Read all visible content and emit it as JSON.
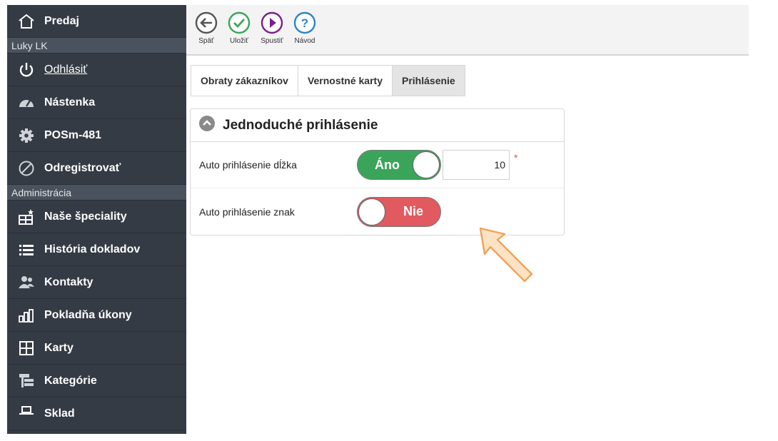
{
  "sidebar": {
    "top_item": {
      "label": "Predaj",
      "icon": "home-icon"
    },
    "user_label": "Luky LK",
    "logout": {
      "label": "Odhlásiť",
      "icon": "power-icon"
    },
    "items_main": [
      {
        "label": "Nástenka",
        "icon": "dashboard-icon"
      },
      {
        "label": "POSm-481",
        "icon": "gear-icon"
      },
      {
        "label": "Odregistrovať",
        "icon": "ban-icon"
      }
    ],
    "section_admin": "Administrácia",
    "items_admin": [
      {
        "label": "Naše špeciality",
        "icon": "specials-icon"
      },
      {
        "label": "História dokladov",
        "icon": "list-icon"
      },
      {
        "label": "Kontakty",
        "icon": "users-icon"
      },
      {
        "label": "Pokladňa úkony",
        "icon": "bars-icon"
      },
      {
        "label": "Karty",
        "icon": "grid-icon"
      },
      {
        "label": "Kategórie",
        "icon": "tree-icon"
      },
      {
        "label": "Sklad",
        "icon": "warehouse-icon"
      }
    ]
  },
  "toolbar": {
    "back": "Späť",
    "save": "Uložiť",
    "run": "Spustiť",
    "help": "Návod"
  },
  "tabs": [
    {
      "label": "Obraty zákazníkov"
    },
    {
      "label": "Vernostné karty"
    },
    {
      "label": "Prihlásenie"
    }
  ],
  "panel": {
    "title": "Jednoduché prihlásenie",
    "rows": [
      {
        "label": "Auto prihlásenie dĺžka",
        "toggle_label": "Áno",
        "value": "10",
        "required": "*"
      },
      {
        "label": "Auto prihlásenie znak",
        "toggle_label": "Nie"
      }
    ]
  },
  "colors": {
    "sidebar_bg": "#353b45",
    "toggle_on": "#3aa55a",
    "toggle_off": "#e05a5f",
    "save_green": "#3aa55a",
    "run_purple": "#7a1f8f",
    "help_blue": "#2b86c5",
    "arrow_orange": "#f7b26a"
  }
}
